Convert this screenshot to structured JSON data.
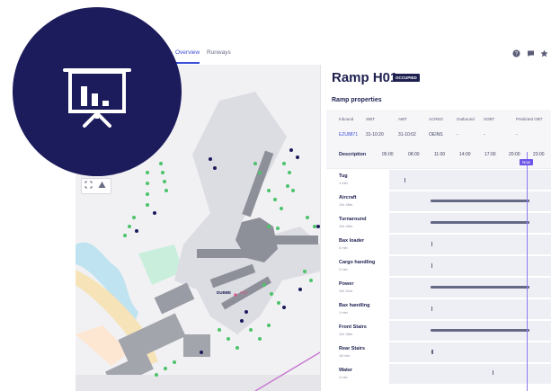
{
  "tabs": [
    {
      "label": "Overview",
      "active": true
    },
    {
      "label": "Runways",
      "active": false
    }
  ],
  "topbar_icons": [
    "help-icon",
    "chat-icon",
    "star-icon"
  ],
  "map": {
    "stand_label": "DUBBE",
    "stand_label_2": "H01"
  },
  "ramp": {
    "title": "Ramp H01",
    "status": "OCCUPIED",
    "section_title": "Ramp properties"
  },
  "properties": {
    "headers": [
      "Inbound",
      "SIBT",
      "AIBT",
      "ACREG",
      "Outbound",
      "SOBT",
      "Predicted OBT"
    ],
    "values": [
      "EZU8871",
      "31-10:20",
      "31-10:02",
      "OEINS",
      "-",
      "-",
      "-"
    ]
  },
  "timeline": {
    "description_label": "Description",
    "hours": [
      "05:00",
      "08:00",
      "11:00",
      "14:00",
      "17:00",
      "20:00",
      "23:00"
    ],
    "now_label": "Now"
  },
  "tasks": [
    {
      "name": "Tug",
      "duration": "1 min"
    },
    {
      "name": "Aircraft",
      "duration": "11h 45m"
    },
    {
      "name": "Turnaround",
      "duration": "11h 45m"
    },
    {
      "name": "Bax loader",
      "duration": "4 min"
    },
    {
      "name": "Cargo handling",
      "duration": "2 min"
    },
    {
      "name": "Power",
      "duration": "11h 41m"
    },
    {
      "name": "Bax handling",
      "duration": "1 min"
    },
    {
      "name": "Front Stairs",
      "duration": "11h 38m"
    },
    {
      "name": "Rear Stairs",
      "duration": "18 min"
    },
    {
      "name": "Water",
      "duration": "4 min"
    }
  ],
  "colors": {
    "brand_navy": "#1c1b5c",
    "accent_blue": "#3b4fd8",
    "now_purple": "#6a55e8",
    "stand_green": "#4cc36a"
  }
}
